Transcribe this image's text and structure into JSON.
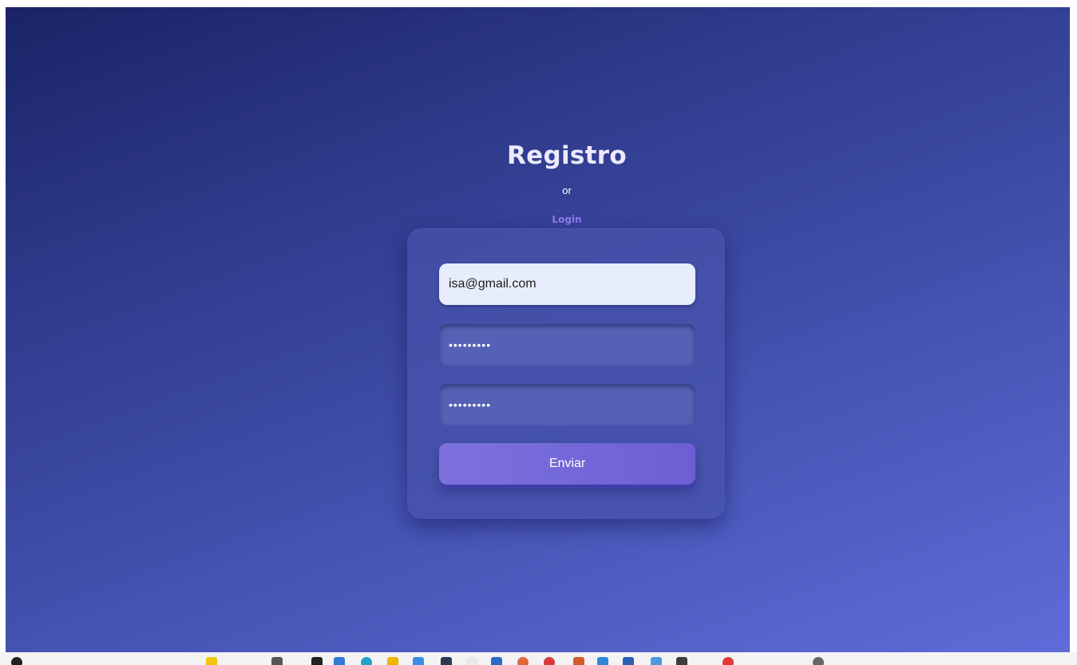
{
  "header": {
    "title": "Registro",
    "or_text": "or",
    "login_link": "Login"
  },
  "form": {
    "email_value": "isa@gmail.com",
    "password_value": "12345678a",
    "confirm_password_value": "12345678a",
    "submit_label": "Enviar"
  },
  "colors": {
    "background_start": "#1b2366",
    "background_end": "#5f6cd9",
    "card": "#4652aa",
    "title": "#ece9ff",
    "login_link": "#8d7cf0",
    "button": "#7c72dd"
  },
  "taskbar": {
    "icons": [
      {
        "name": "search-icon",
        "color": "#222222"
      },
      {
        "name": "widgets-icon",
        "color": "#f2c40f"
      },
      {
        "name": "task-view-icon",
        "color": "#555555"
      },
      {
        "name": "github-icon",
        "color": "#222222"
      },
      {
        "name": "vscode-icon",
        "color": "#2f7ad6"
      },
      {
        "name": "edge-icon",
        "color": "#1fa3c9"
      },
      {
        "name": "explorer-icon",
        "color": "#f0b400"
      },
      {
        "name": "store-icon",
        "color": "#3a8ee6"
      },
      {
        "name": "terminal-icon",
        "color": "#2b3a55"
      },
      {
        "name": "chrome-icon",
        "color": "#e8e8e8"
      },
      {
        "name": "outlook-icon",
        "color": "#2a6bc7"
      },
      {
        "name": "app-orange-icon",
        "color": "#e2673b"
      },
      {
        "name": "app-red-icon",
        "color": "#d83b3b"
      },
      {
        "name": "powerpoint-icon",
        "color": "#d35b2a"
      },
      {
        "name": "app-blue-icon",
        "color": "#2d8ad8"
      },
      {
        "name": "word-icon",
        "color": "#2b5fb5"
      },
      {
        "name": "app-lightblue-icon",
        "color": "#4a9be0"
      },
      {
        "name": "app-dark-icon",
        "color": "#3d3d3d"
      },
      {
        "name": "app-red2-icon",
        "color": "#e53935"
      },
      {
        "name": "app-gray-icon",
        "color": "#666666"
      }
    ]
  }
}
